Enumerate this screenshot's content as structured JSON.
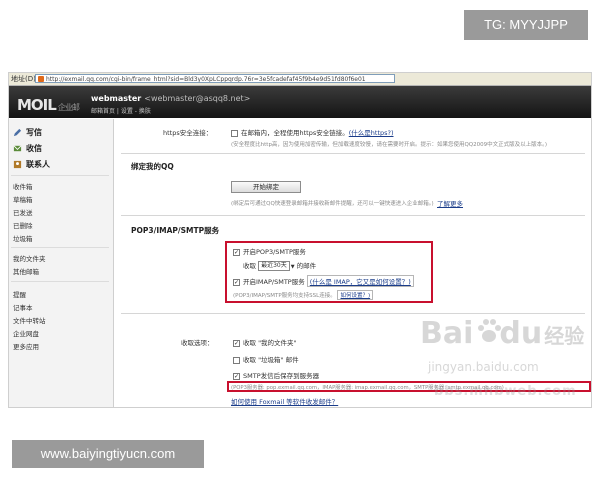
{
  "overlay": {
    "tg": "TG: MYYJJPP",
    "website": "www.baiyingtiyucn.com"
  },
  "browser": {
    "address_label": "地址(D)",
    "url": "http://exmail.qq.com/cgi-bin/frame_html?sid=Bld3y0XpLCppqrdp.76r=3e5fcadefaf45f9b4e9d51fd80f6e01"
  },
  "header": {
    "logo": "MOIL",
    "logo_sub": "企业邮",
    "user": "webmaster",
    "email": "<webmaster@asqq8.net>",
    "links": "邮箱首页 | 设置 - 换肤"
  },
  "sidebar": {
    "primary": [
      {
        "label": "写信",
        "icon": "pen-icon"
      },
      {
        "label": "收信",
        "icon": "inbox-icon"
      },
      {
        "label": "联系人",
        "icon": "contacts-icon"
      }
    ],
    "group1": [
      "收件箱",
      "草稿箱",
      "已发送",
      "已删除",
      "垃圾箱"
    ],
    "group2": [
      "我的文件夹",
      "其他邮箱"
    ],
    "group3": [
      "提醒",
      "记事本",
      "文件中转站",
      "企业网盘",
      "更多应用"
    ]
  },
  "https": {
    "label": "https安全连接：",
    "option": "在邮箱内，全程使用https安全链接。",
    "link": "(什么是https?)",
    "note": "(安全程度比http高，因为使用加密传输，但加载速度较慢，请在需要时开启。提示：如果您使用QQ2009中文正式版及以上版本。)"
  },
  "bindqq": {
    "title": "绑定我的QQ",
    "button": "开始绑定",
    "note": "(绑定后可通过QQ快速登录邮箱并接收新邮件提醒，还可以一键快速进入企业邮箱。)",
    "more": "了解更多"
  },
  "pop": {
    "title": "POP3/IMAP/SMTP服务",
    "pop_option": "开启POP3/SMTP服务",
    "receive_label": "收取",
    "receive_select": "最近30天",
    "receive_suffix": "的邮件",
    "imap_option": "开启IMAP/SMTP服务",
    "imap_link": "(什么是 IMAP，它又是如何设置？)",
    "ssl_note": "(POP3/IMAP/SMTP服务均支持SSL连接。",
    "ssl_link": "如何设置？)"
  },
  "receive": {
    "label": "收取选项：",
    "opt1": "收取 \"我的文件夹\"",
    "opt2": "收取 \"垃圾箱\" 邮件",
    "opt3": "SMTP发信后保存到服务器",
    "servers": "(POP3服务器: pop.exmail.qq.com，IMAP服务器: imap.exmail.qq.com，SMTP服务器: smtp.exmail.qq.com)",
    "foxmail": "如何使用 Foxmail 等软件收发邮件？"
  },
  "watermark": {
    "logo": "Bai",
    "logo2": "du",
    "cn": "经验",
    "site": "jingyan.baidu.com",
    "bbs": "bbs.mhbweb.com"
  }
}
